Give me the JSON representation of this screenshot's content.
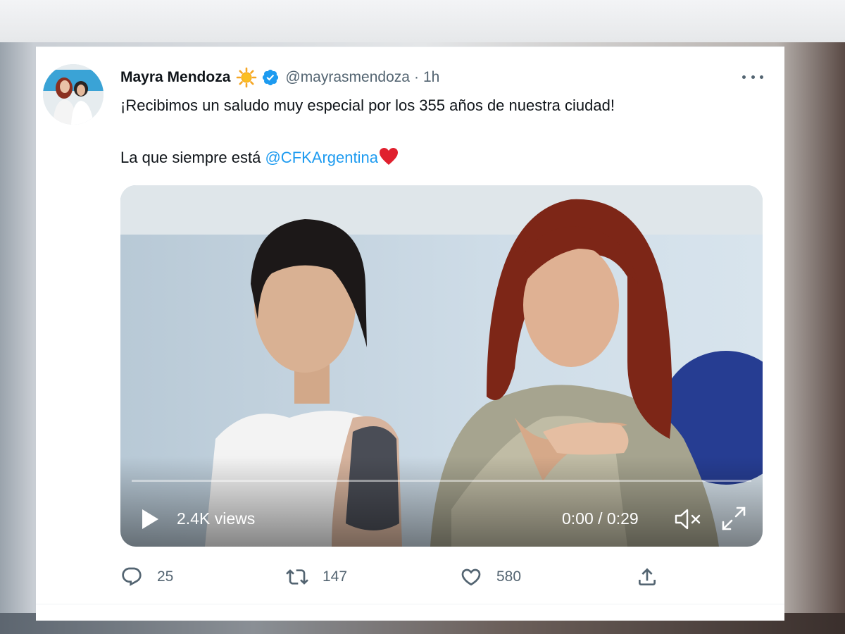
{
  "tweet": {
    "author": {
      "display_name": "Mayra Mendoza",
      "handle": "@mayrasmendoza",
      "separator": "·",
      "time": "1h"
    },
    "text": {
      "line1": "¡Recibimos un saludo muy especial por los 355 años de nuestra ciudad!",
      "line2_prefix": "La que siempre está ",
      "mention": "@CFKArgentina"
    },
    "video": {
      "views": "2.4K views",
      "time": "0:00 / 0:29",
      "progress": 0
    },
    "actions": {
      "replies": "25",
      "retweets": "147",
      "likes": "580"
    }
  },
  "icons": {
    "sun": "sun-emoji-icon",
    "verified": "verified-badge-icon",
    "heart": "red-heart-emoji-icon",
    "more": "more-options-icon",
    "play": "play-icon",
    "mute": "muted-speaker-icon",
    "fullscreen": "fullscreen-icon",
    "reply": "reply-icon",
    "retweet": "retweet-icon",
    "like": "like-heart-icon",
    "share": "share-icon"
  },
  "colors": {
    "accent": "#1d9bf0",
    "text": "#0f1419",
    "secondary": "#536471",
    "heart_emoji": "#e0202e",
    "sun_emoji": "#f5a623"
  }
}
